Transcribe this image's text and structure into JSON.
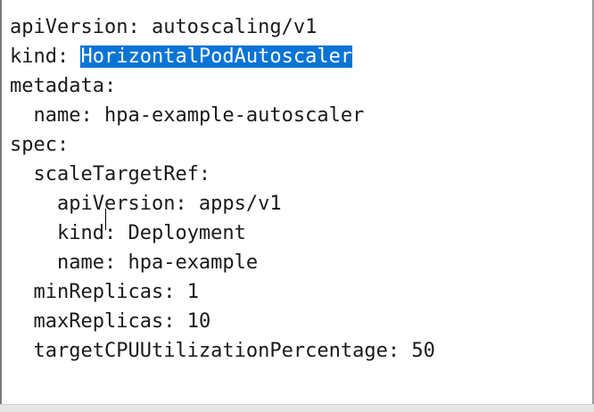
{
  "editor": {
    "lines": [
      {
        "indent": "",
        "key": "apiVersion:",
        "value": " autoscaling/v1",
        "selected": ""
      },
      {
        "indent": "",
        "key": "kind: ",
        "value": "",
        "selected": "HorizontalPodAutoscaler"
      },
      {
        "indent": "",
        "key": "metadata:",
        "value": "",
        "selected": ""
      },
      {
        "indent": "  ",
        "key": "name:",
        "value": " hpa-example-autoscaler",
        "selected": ""
      },
      {
        "indent": "",
        "key": "spec:",
        "value": "",
        "selected": ""
      },
      {
        "indent": "  ",
        "key": "scaleTargetRef:",
        "value": "",
        "selected": ""
      },
      {
        "indent": "    ",
        "key": "apiVersion:",
        "value": " apps/v1",
        "selected": ""
      },
      {
        "indent": "    ",
        "key": "kind:",
        "value": " Deployment",
        "selected": ""
      },
      {
        "indent": "    ",
        "key": "name:",
        "value": " hpa-example",
        "selected": ""
      },
      {
        "indent": "  ",
        "key": "minReplicas:",
        "value": " 1",
        "selected": ""
      },
      {
        "indent": "  ",
        "key": "maxReplicas:",
        "value": " 10",
        "selected": ""
      },
      {
        "indent": "  ",
        "key": "targetCPUUtilizationPercentage:",
        "value": " 50",
        "selected": ""
      }
    ],
    "selection_color": "#0a74d6",
    "text_color": "#1a1a1a"
  }
}
